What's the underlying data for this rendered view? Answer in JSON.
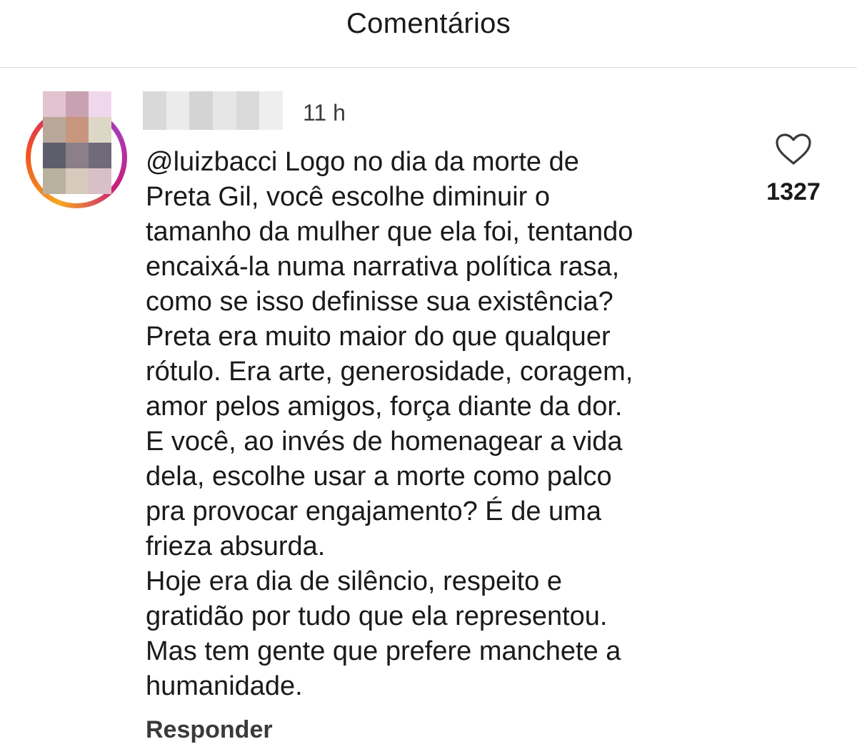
{
  "header": {
    "title": "Comentários"
  },
  "comment": {
    "timestamp": "11 h",
    "lines": [
      "@luizbacci Logo no dia da morte de",
      "Preta Gil, você escolhe diminuir o",
      "tamanho da mulher que ela foi, tentando",
      "encaixá-la numa narrativa política rasa,",
      "como se isso definisse sua existência?",
      "Preta era muito maior do que qualquer",
      "rótulo. Era arte, generosidade, coragem,",
      "amor pelos amigos, força diante da dor.",
      "E você, ao invés de homenagear a vida",
      "dela, escolhe usar a morte como palco",
      "pra provocar engajamento? É de uma",
      "frieza absurda.",
      "Hoje era dia de silêncio, respeito e",
      "gratidão por tudo que ela representou.",
      "Mas tem gente que prefere manchete a",
      "humanidade."
    ],
    "like_count": "1327",
    "like_icon": "heart-outline-icon",
    "reply_label": "Responder"
  },
  "avatar": {
    "story_ring_colors": [
      "#f5a623",
      "#f0561f",
      "#d4266f",
      "#a53bb8"
    ],
    "pixel_colors": [
      "#e3c3cf",
      "#c9a2b1",
      "#f0d8ec",
      "#b9a89a",
      "#c8967e",
      "#ddd7c6",
      "#5e5d6b",
      "#8b7f88",
      "#6f6b7a",
      "#b9b19f",
      "#d8c9bd",
      "#d8bfc8"
    ]
  },
  "username_blur": {
    "pixel_colors": [
      "#d9d9d9",
      "#ebebeb",
      "#d4d4d4",
      "#e6e6e6",
      "#dadada",
      "#eeeeee"
    ]
  }
}
